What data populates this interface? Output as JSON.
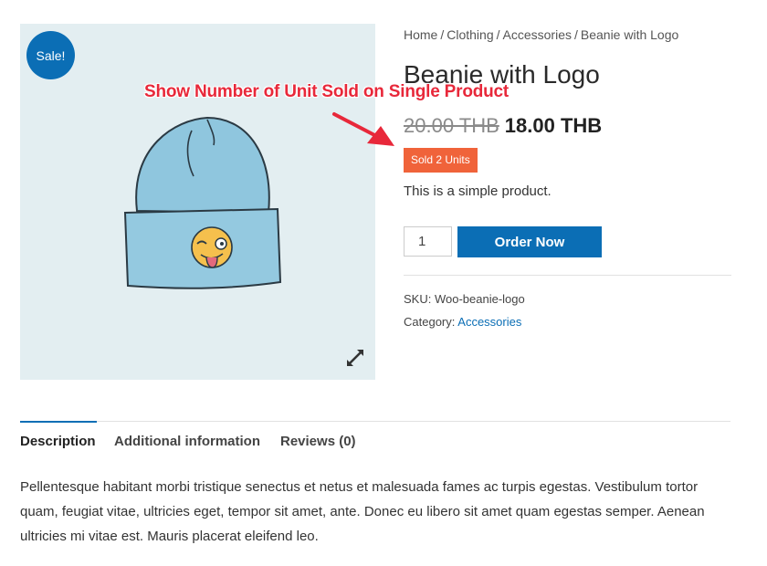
{
  "gallery": {
    "sale_label": "Sale!"
  },
  "breadcrumb": {
    "items": [
      "Home",
      "Clothing",
      "Accessories",
      "Beanie with Logo"
    ],
    "separator": "/"
  },
  "product": {
    "title": "Beanie with Logo",
    "old_price": "20.00 THB",
    "new_price": "18.00 THB",
    "sold_label": "Sold 2 Units",
    "short_description": "This is a simple product.",
    "quantity": "1",
    "order_button": "Order Now",
    "sku_label": "SKU:",
    "sku_value": "Woo-beanie-logo",
    "category_label": "Category:",
    "category_value": "Accessories"
  },
  "annotation": {
    "text": "Show Number of Unit Sold on Single Product"
  },
  "tabs": [
    {
      "label": "Description",
      "active": true
    },
    {
      "label": "Additional information",
      "active": false
    },
    {
      "label": "Reviews (0)",
      "active": false
    }
  ],
  "description": {
    "text": "Pellentesque habitant morbi tristique senectus et netus et malesuada fames ac turpis egestas. Vestibulum tortor quam, feugiat vitae, ultricies eget, tempor sit amet, ante. Donec eu libero sit amet quam egestas semper. Aenean ultricies mi vitae est. Mauris placerat eleifend leo."
  },
  "colors": {
    "accent": "#0b6eb5",
    "sold_badge": "#f0633a",
    "annotation": "#e8283a",
    "gallery_bg": "#e3eef1"
  },
  "icons": {
    "expand": "expand-arrows-icon",
    "arrow": "red-arrow-icon"
  }
}
